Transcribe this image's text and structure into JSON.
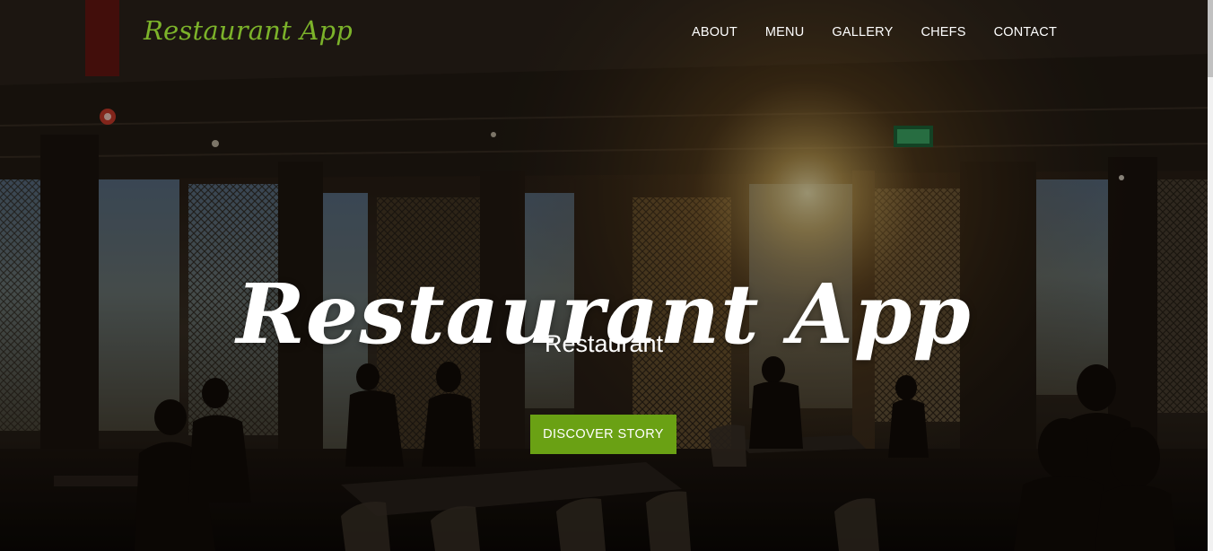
{
  "brand": {
    "name": "Restaurant App",
    "color": "#7cb32a"
  },
  "nav": {
    "items": [
      {
        "label": "ABOUT"
      },
      {
        "label": "MENU"
      },
      {
        "label": "GALLERY"
      },
      {
        "label": "CHEFS"
      },
      {
        "label": "CONTACT"
      }
    ]
  },
  "hero": {
    "title": "Restaurant App",
    "subtitle": "Restaurant",
    "cta_label": "DISCOVER STORY",
    "cta_color": "#6aa114",
    "background": "restaurant-interior-photo"
  }
}
